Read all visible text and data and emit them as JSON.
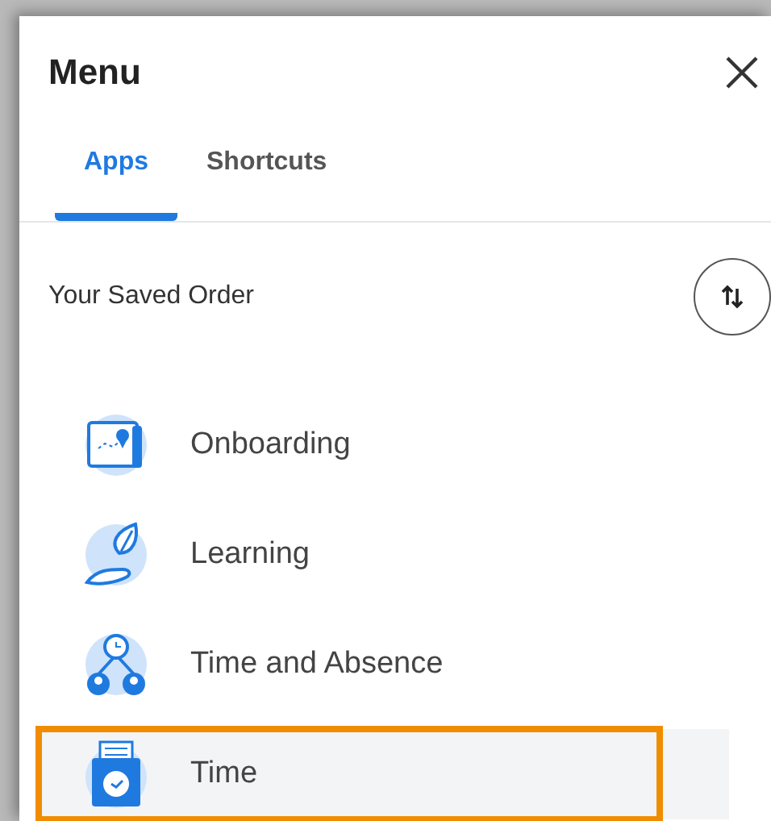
{
  "title": "Menu",
  "tabs": [
    {
      "label": "Apps",
      "selected": true
    },
    {
      "label": "Shortcuts",
      "selected": false
    }
  ],
  "section_label": "Your Saved Order",
  "items": [
    {
      "label": "Onboarding",
      "highlighted": false
    },
    {
      "label": "Learning",
      "highlighted": false
    },
    {
      "label": "Time and Absence",
      "highlighted": false
    },
    {
      "label": "Time",
      "highlighted": true
    }
  ]
}
